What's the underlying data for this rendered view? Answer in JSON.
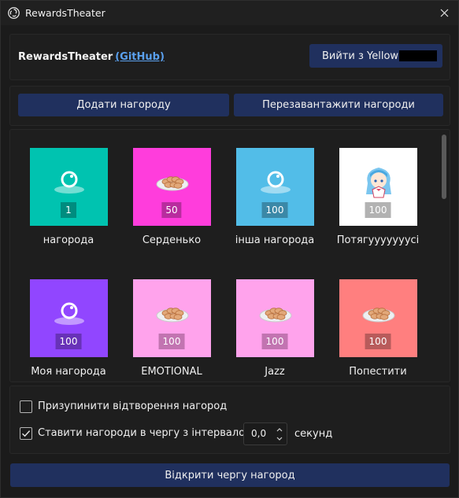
{
  "window": {
    "title": "RewardsTheater"
  },
  "header": {
    "brand": "RewardsTheater",
    "github_link": "(GitHub)",
    "logout_label": "Вийти з Yellow"
  },
  "actions": {
    "add_label": "Додати нагороду",
    "reload_label": "Перезавантажити нагороди"
  },
  "rewards": [
    {
      "name": "нагорода",
      "cost": "1",
      "color": "#00c3b0",
      "icon": "obs-bubble-icon"
    },
    {
      "name": "Серденько",
      "cost": "50",
      "color": "#ff3ddc",
      "icon": "cookie-plate-icon"
    },
    {
      "name": "інша нагорода",
      "cost": "100",
      "color": "#52bde8",
      "icon": "obs-bubble-icon"
    },
    {
      "name": "Потягууууууусі",
      "cost": "100",
      "color": "#ffffff",
      "icon": "anime-girl-image"
    },
    {
      "name": "Моя нагорода",
      "cost": "100",
      "color": "#9146ff",
      "icon": "obs-bubble-icon"
    },
    {
      "name": "EMOTIONAL",
      "cost": "100",
      "color": "#ffa3ec",
      "icon": "cookie-plate-icon"
    },
    {
      "name": "Jazz",
      "cost": "100",
      "color": "#ffa3ec",
      "icon": "cookie-plate-icon"
    },
    {
      "name": "Попестити",
      "cost": "100",
      "color": "#ff7f7f",
      "icon": "cookie-plate-icon"
    }
  ],
  "options": {
    "pause_label": "Призупинити відтворення нагород",
    "pause_checked": false,
    "queue_label": "Ставити нагороди в чергу з інтервалом у",
    "queue_checked": true,
    "interval_value": "0,0",
    "interval_unit": "секунд"
  },
  "footer": {
    "open_queue_label": "Відкрити чергу нагород"
  },
  "colors": {
    "button": "#20305e",
    "link": "#5aa0ee",
    "background": "#1b1b1b"
  }
}
